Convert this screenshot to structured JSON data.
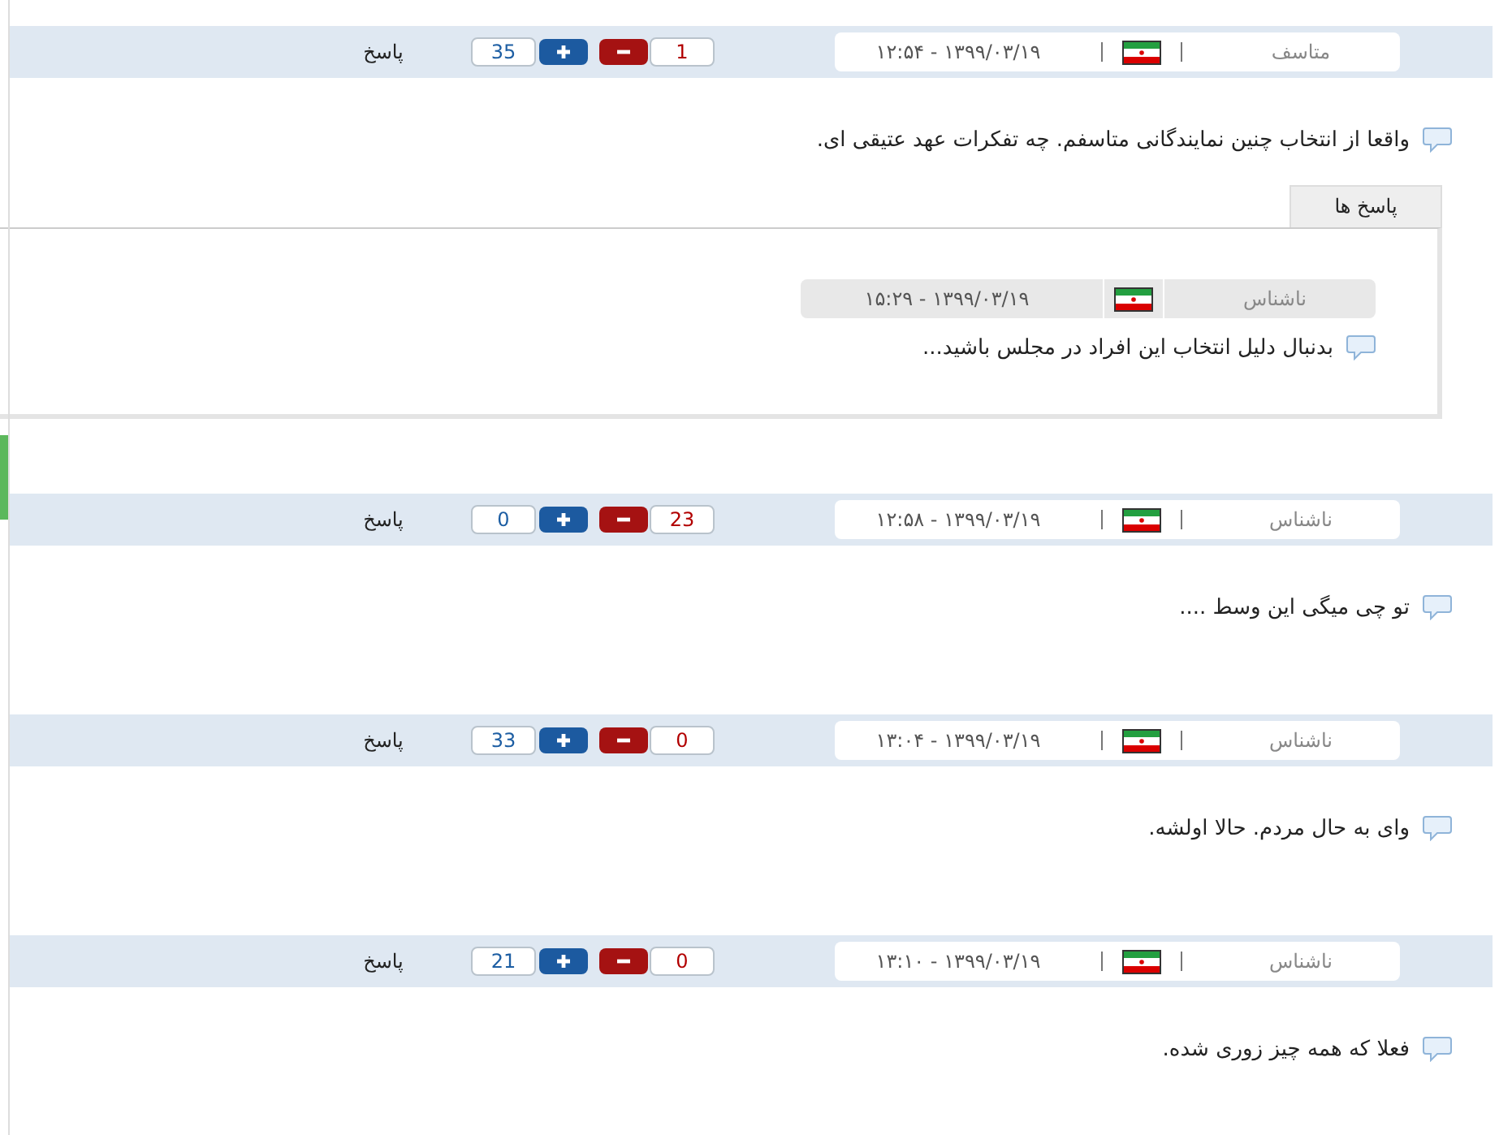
{
  "comments": [
    {
      "author": "متاسف",
      "date": "۱۳۹۹/۰۳/۱۹ - ۱۲:۵۴",
      "likes": "35",
      "dislikes": "1",
      "reply_label": "پاسخ",
      "text": "واقعا از انتخاب چنین نمایندگانی متاسفم. چه تفکرات عهد عتیقی ای.",
      "replies_title": "پاسخ ها",
      "replies": [
        {
          "author": "ناشناس",
          "date": "۱۳۹۹/۰۳/۱۹ - ۱۵:۲۹",
          "text": "بدنبال دلیل انتخاب این افراد در مجلس باشید..."
        }
      ]
    },
    {
      "author": "ناشناس",
      "date": "۱۳۹۹/۰۳/۱۹ - ۱۲:۵۸",
      "likes": "0",
      "dislikes": "23",
      "reply_label": "پاسخ",
      "text": "تو چی میگی این وسط ...."
    },
    {
      "author": "ناشناس",
      "date": "۱۳۹۹/۰۳/۱۹ - ۱۳:۰۴",
      "likes": "33",
      "dislikes": "0",
      "reply_label": "پاسخ",
      "text": "وای به حال مردم. حالا اولشه."
    },
    {
      "author": "ناشناس",
      "date": "۱۳۹۹/۰۳/۱۹ - ۱۳:۱۰",
      "likes": "21",
      "dislikes": "0",
      "reply_label": "پاسخ",
      "text": "فعلا که همه چیز زوری شده."
    }
  ]
}
